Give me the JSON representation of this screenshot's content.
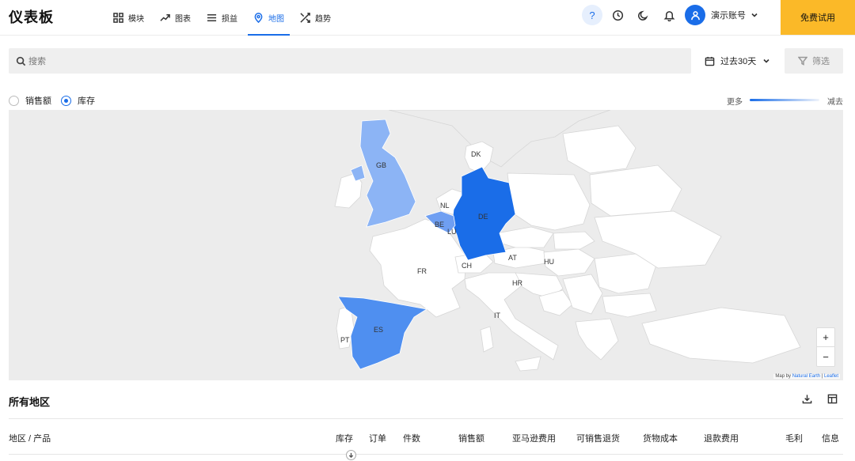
{
  "header": {
    "title": "仪表板",
    "tabs": [
      {
        "label": "模块",
        "icon": "grid-icon"
      },
      {
        "label": "图表",
        "icon": "trend-icon"
      },
      {
        "label": "损益",
        "icon": "list-icon"
      },
      {
        "label": "地图",
        "icon": "map-pin-icon",
        "active": true
      },
      {
        "label": "趋势",
        "icon": "shuffle-icon"
      }
    ],
    "help_label": "?",
    "account_label": "演示账号",
    "trial_label": "免费试用"
  },
  "toolbar": {
    "search_placeholder": "搜索",
    "date_range": "过去30天",
    "filter_label": "筛选"
  },
  "map_controls": {
    "radio_sales": "销售额",
    "radio_inventory": "库存",
    "selected": "库存",
    "legend_more": "更多",
    "legend_less": "减去",
    "zoom_in": "+",
    "zoom_out": "−",
    "attribution_prefix": "Map by",
    "attribution_natural_earth": "Natural Earth",
    "attribution_sep": "|",
    "attribution_leaflet": "Leaflet"
  },
  "map_labels": {
    "GB": "GB",
    "DK": "DK",
    "NL": "NL",
    "DE": "DE",
    "BE": "BE",
    "LU": "LU",
    "FR": "FR",
    "CH": "CH",
    "AT": "AT",
    "HU": "HU",
    "HR": "HR",
    "IT": "IT",
    "ES": "ES",
    "PT": "PT"
  },
  "colors": {
    "accent": "#1a6de8",
    "trial_button": "#fbb928",
    "de_fill": "#1a6de8",
    "es_fill": "#4f8ff0",
    "gb_fill": "#8cb4f5",
    "be_fill": "#6f9ff2"
  },
  "table": {
    "section_title": "所有地区",
    "columns": [
      "地区 / 产品",
      "库存",
      "订单",
      "件数",
      "销售额",
      "亚马逊费用",
      "可销售退货",
      "货物成本",
      "退款费用",
      "毛利",
      "信息"
    ]
  }
}
